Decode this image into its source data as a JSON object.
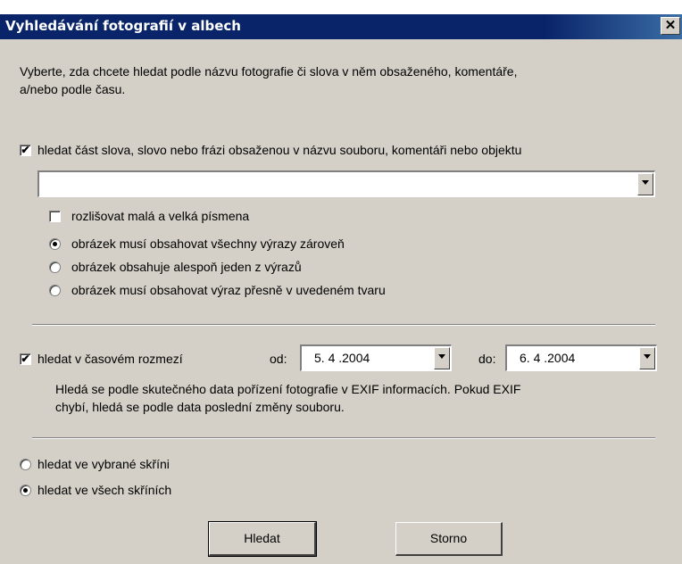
{
  "window": {
    "title": "Vyhledávání fotografií v albech",
    "close_label": "✕"
  },
  "intro": {
    "line1": "Vyberte, zda chcete hledat podle názvu fotografie či slova v něm obsaženého, komentáře,",
    "line2": "a/nebo podle času."
  },
  "text_search": {
    "checked": true,
    "label": "hledat část slova, slovo nebo frázi obsaženou v názvu souboru, komentáři nebo objektu",
    "input_value": "",
    "case_sensitive": {
      "checked": false,
      "label": "rozlišovat malá a velká písmena"
    },
    "match_options": [
      {
        "label": "obrázek musí obsahovat všechny výrazy zároveň",
        "selected": true
      },
      {
        "label": "obrázek obsahuje alespoň jeden z výrazů",
        "selected": false
      },
      {
        "label": "obrázek musí obsahovat výraz přesně v uvedeném tvaru",
        "selected": false
      }
    ]
  },
  "date_search": {
    "checked": true,
    "label": "hledat v časovém rozmezí",
    "from_label": "od:",
    "from_value": "5. 4 .2004",
    "to_label": "do:",
    "to_value": "6. 4 .2004",
    "note_line1": "Hledá se podle skutečného data pořízení fotografie v EXIF informacích. Pokud EXIF",
    "note_line2": "chybí, hledá se podle data poslední změny souboru."
  },
  "scope": {
    "options": [
      {
        "label": "hledat ve vybrané skříni",
        "selected": false
      },
      {
        "label": "hledat ve všech skříních",
        "selected": true
      }
    ]
  },
  "buttons": {
    "search_label": "Hledat",
    "cancel_label": "Storno"
  },
  "glyphs": {
    "check": "✔"
  }
}
